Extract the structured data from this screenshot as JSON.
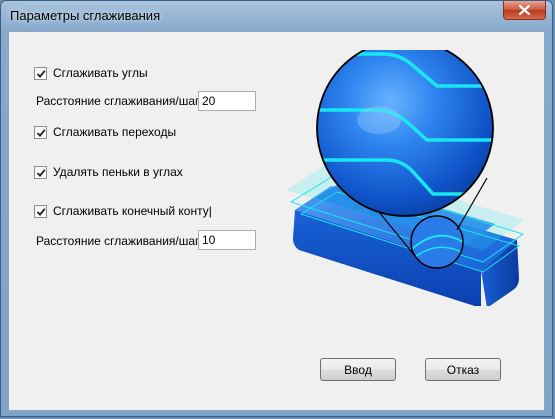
{
  "window": {
    "title": "Параметры сглаживания",
    "close_icon": "close-icon"
  },
  "options": {
    "smooth_corners": {
      "label": "Сглаживать углы",
      "checked": true
    },
    "smooth_distance_1": {
      "label": "Расстояние сглаживания/шаг",
      "value": "20"
    },
    "smooth_transitions": {
      "label": "Сглаживать переходы",
      "checked": true
    },
    "remove_stumps": {
      "label": "Удалять пеньки в углах",
      "checked": true
    },
    "smooth_final_contour": {
      "label": "Сглаживать конечный конту|",
      "checked": true
    },
    "smooth_distance_2": {
      "label": "Расстояние сглаживания/шаг",
      "value": "10"
    }
  },
  "buttons": {
    "ok": "Ввод",
    "cancel": "Отказ"
  },
  "colors": {
    "part_blue": "#0b55d6",
    "toolpath_cyan": "#19e6f0"
  }
}
